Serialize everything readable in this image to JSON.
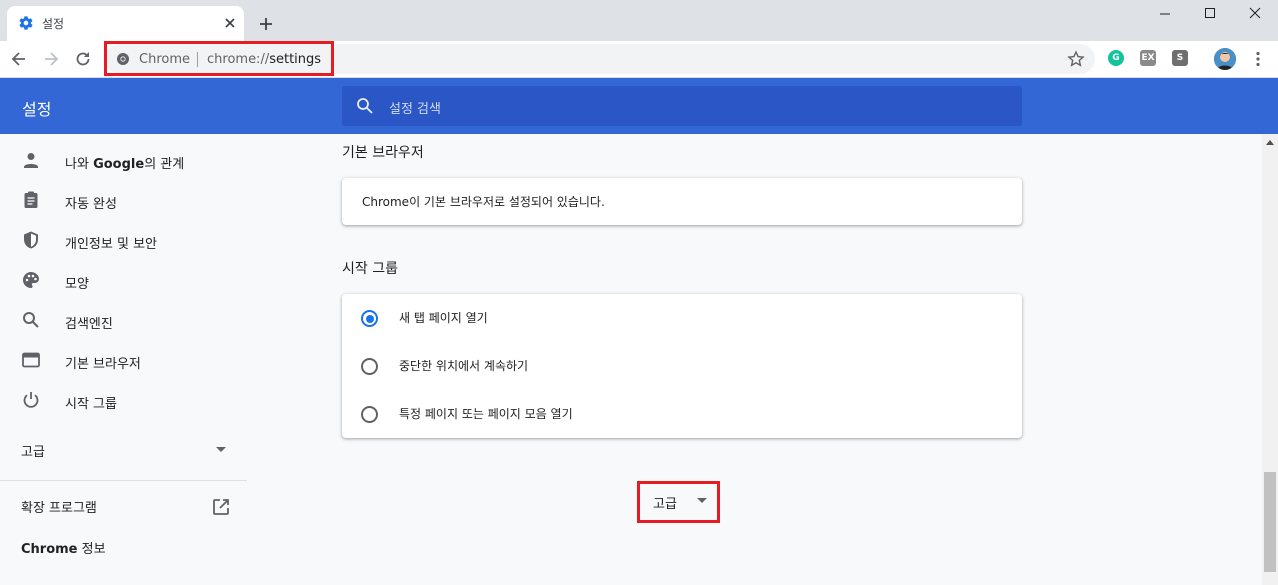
{
  "tab": {
    "title": "설정"
  },
  "omnibox": {
    "site_label": "Chrome",
    "url_scheme": "chrome://",
    "url_host": "settings"
  },
  "extensions": [
    {
      "name": "grammarly",
      "glyph": "G",
      "color": "#15c39a"
    },
    {
      "name": "ext-gray",
      "glyph": "EX",
      "color": "#8a8a8a"
    },
    {
      "name": "ext-s",
      "glyph": "S",
      "color": "#6f6f6f"
    }
  ],
  "header": {
    "title": "설정",
    "search_placeholder": "설정 검색"
  },
  "sidebar": {
    "items": [
      {
        "label_before": "나와 ",
        "label_bold": "Google",
        "label_after": "의 관계",
        "icon": "person-icon"
      },
      {
        "label": "자동 완성",
        "icon": "clipboard-icon"
      },
      {
        "label": "개인정보 및 보안",
        "icon": "shield-icon"
      },
      {
        "label": "모양",
        "icon": "palette-icon"
      },
      {
        "label": "검색엔진",
        "icon": "search-icon"
      },
      {
        "label": "기본 브라우저",
        "icon": "browser-icon"
      },
      {
        "label": "시작 그룹",
        "icon": "power-icon"
      }
    ],
    "advanced": "고급",
    "extensions": "확장 프로그램",
    "about_bold": "Chrome",
    "about_after": " 정보"
  },
  "main": {
    "default_browser": {
      "title": "기본 브라우저",
      "text": "Chrome이 기본 브라우저로 설정되어 있습니다."
    },
    "startup": {
      "title": "시작 그룹",
      "options": [
        {
          "label": "새 탭 페이지 열기",
          "selected": true
        },
        {
          "label": "중단한 위치에서 계속하기",
          "selected": false
        },
        {
          "label": "특정 페이지 또는 페이지 모음 열기",
          "selected": false
        }
      ]
    },
    "advanced_button": "고급"
  },
  "colors": {
    "accent": "#3367d6",
    "highlight": "#e51c23",
    "radio_on": "#1a73e8"
  }
}
